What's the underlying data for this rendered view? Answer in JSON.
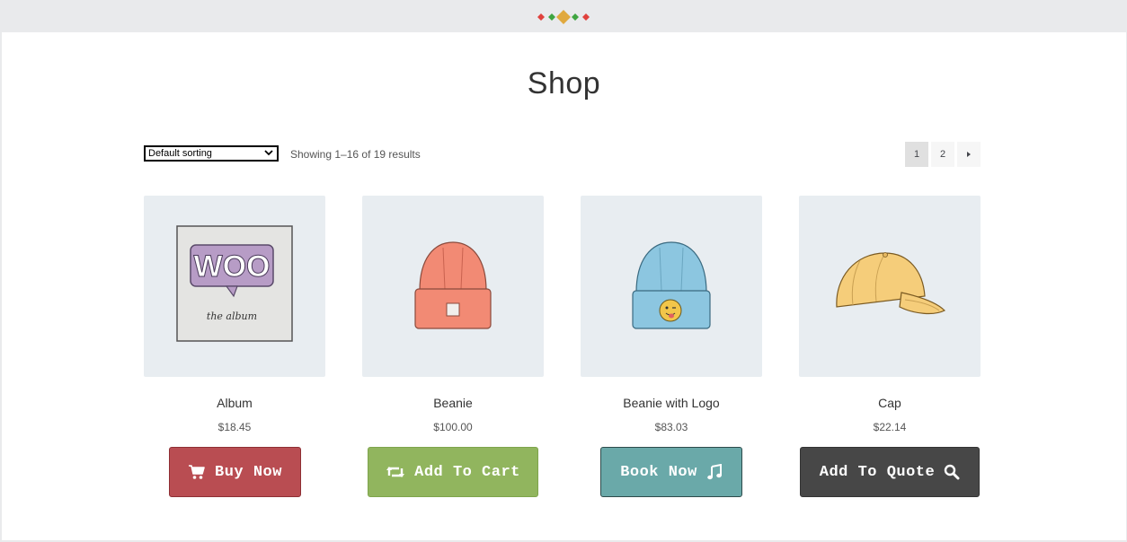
{
  "page": {
    "title": "Shop"
  },
  "toolbar": {
    "sort_selected": "Default sorting",
    "result_count": "Showing 1–16 of 19 results"
  },
  "pagination": {
    "pages": [
      "1",
      "2"
    ],
    "current": "1",
    "next_icon": "caret-right-icon"
  },
  "products": [
    {
      "name": "Album",
      "price": "$18.45",
      "button_label": "Buy Now",
      "button_icon": "cart-icon",
      "button_color": "#b94d52"
    },
    {
      "name": "Beanie",
      "price": "$100.00",
      "button_label": "Add To Cart",
      "button_icon": "retweet-icon",
      "button_color": "#91b55e"
    },
    {
      "name": "Beanie with Logo",
      "price": "$83.03",
      "button_label": "Book Now",
      "button_icon": "music-icon",
      "button_color": "#6aa9a9"
    },
    {
      "name": "Cap",
      "price": "$22.14",
      "button_label": "Add To Quote",
      "button_icon": "search-icon",
      "button_color": "#474747"
    }
  ],
  "album_art": {
    "logo_text": "WOO",
    "caption": "the album"
  }
}
